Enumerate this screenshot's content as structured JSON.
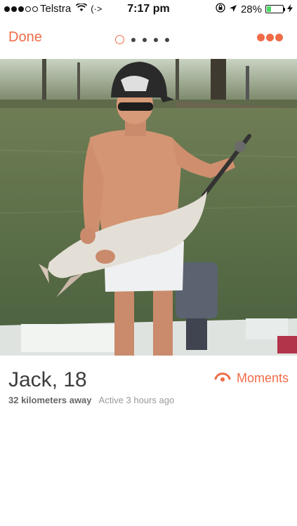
{
  "status_bar": {
    "carrier": "Telstra",
    "time": "7:17 pm",
    "battery": "28%",
    "battery_level": 0.28,
    "signal_bars_filled": 3,
    "signal_bars_total": 5
  },
  "nav": {
    "done_label": "Done",
    "page_count": 5,
    "current_page": 1
  },
  "profile": {
    "name": "Jack",
    "age_text": ", 18",
    "distance": "32 kilometers away",
    "active": "Active 3 hours ago",
    "moments_label": "Moments"
  },
  "colors": {
    "accent": "#f06c47"
  }
}
